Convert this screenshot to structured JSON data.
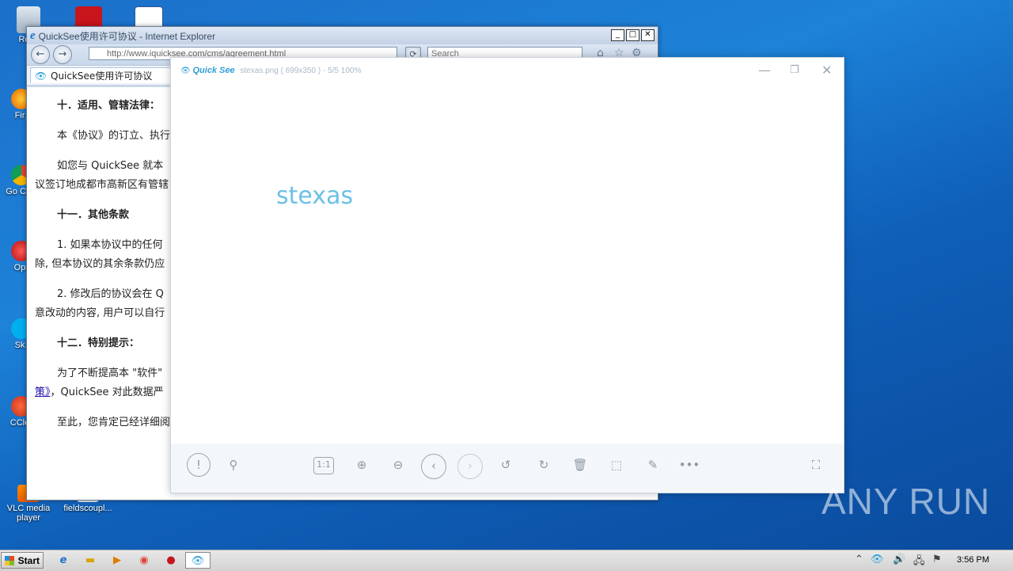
{
  "desktop": {
    "icons": [
      {
        "label": "Recy"
      },
      {
        "label": "Fir"
      },
      {
        "label": "Go Chr"
      },
      {
        "label": "Op"
      },
      {
        "label": "Sk"
      },
      {
        "label": "CCle"
      },
      {
        "label": "VLC media player"
      },
      {
        "label": "fieldscoupl..."
      }
    ]
  },
  "ie": {
    "title": "QuickSee使用许可协议 - Internet Explorer",
    "address": "http://www.iquicksee.com/cms/agreement.html",
    "search_placeholder": "Search",
    "tab_title": "QuickSee使用许可协议",
    "content": {
      "p1": "十．适用、管辖法律：",
      "p2": "本《协议》的订立、执行",
      "p3a": "如您与 QuickSee 就本",
      "p3b": "议签订地成都市高新区有管辖",
      "p4": "十一．其他条款",
      "p5a": "1. 如果本协议中的任何",
      "p5b": "除, 但本协议的其余条款仍应",
      "p6a": "2. 修改后的协议会在 Q",
      "p6b": "意改动的内容, 用户可以自行",
      "p7": "十二．特别提示：",
      "p8a": "为了不断提高本 \"软件\"",
      "p8b_link": "策》",
      "p8b_rest": "，QuickSee 对此数据严",
      "p9": "至此，您肯定已经详细阅"
    }
  },
  "viewer": {
    "brand": "Quick See",
    "file_info": "stexas.png ( 699x350 ) - 5/5 100%",
    "image_text": "stexas",
    "toolbar": [
      "info-icon",
      "location-icon",
      "actual-size-icon",
      "zoom-in-icon",
      "zoom-out-icon",
      "previous-icon",
      "next-icon",
      "rotate-left-icon",
      "rotate-right-icon",
      "delete-icon",
      "crop-icon",
      "edit-icon",
      "more-icon",
      "fullscreen-icon"
    ],
    "actual_size_label": "1:1"
  },
  "taskbar": {
    "start_label": "Start",
    "clock": "3:56 PM"
  },
  "watermark": "ANY RUN"
}
